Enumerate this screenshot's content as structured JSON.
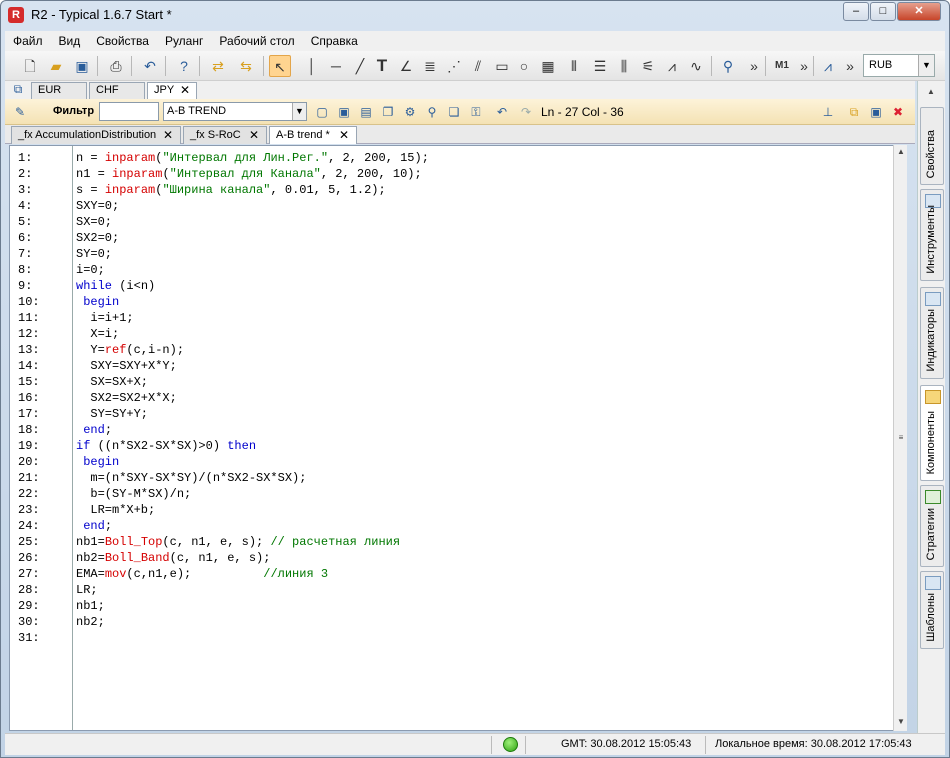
{
  "window": {
    "title": "R2 - Typical 1.6.7 Start *",
    "app_icon": "R"
  },
  "window_controls": {
    "minimize": "‒",
    "maximize": "□",
    "close": "✕"
  },
  "menu": [
    "Файл",
    "Вид",
    "Свойства",
    "Руланг",
    "Рабочий стол",
    "Справка"
  ],
  "toolbar": {
    "currency": "RUB",
    "m1": "M1",
    "more": "»",
    "text_tool": "T"
  },
  "currency_tabs": [
    "EUR",
    "CHF",
    "JPY"
  ],
  "filter": {
    "label": "Фильтр",
    "value": "",
    "selected": "A-B TREND",
    "position": "Ln - 27  Col - 36"
  },
  "file_tabs": [
    "_fx AccumulationDistribution",
    "_fx S-RoC",
    "A-B trend *"
  ],
  "code_lines": [
    {
      "n": "1:",
      "parts": [
        [
          "t",
          "n = "
        ],
        [
          "fn",
          "inparam"
        ],
        [
          "t",
          "("
        ],
        [
          "str",
          "\"Интервал для Лин.Рег.\""
        ],
        [
          "t",
          ", 2, 200, 15);"
        ]
      ]
    },
    {
      "n": "2:",
      "parts": [
        [
          "t",
          "n1 = "
        ],
        [
          "fn",
          "inparam"
        ],
        [
          "t",
          "("
        ],
        [
          "str",
          "\"Интервал для Канала\""
        ],
        [
          "t",
          ", 2, 200, 10);"
        ]
      ]
    },
    {
      "n": "3:",
      "parts": [
        [
          "t",
          "s = "
        ],
        [
          "fn",
          "inparam"
        ],
        [
          "t",
          "("
        ],
        [
          "str",
          "\"Ширина канала\""
        ],
        [
          "t",
          ", 0.01, 5, 1.2);"
        ]
      ]
    },
    {
      "n": "4:",
      "parts": [
        [
          "t",
          "SXY=0;"
        ]
      ]
    },
    {
      "n": "5:",
      "parts": [
        [
          "t",
          "SX=0;"
        ]
      ]
    },
    {
      "n": "6:",
      "parts": [
        [
          "t",
          "SX2=0;"
        ]
      ]
    },
    {
      "n": "7:",
      "parts": [
        [
          "t",
          "SY=0;"
        ]
      ]
    },
    {
      "n": "8:",
      "parts": [
        [
          "t",
          "i=0;"
        ]
      ]
    },
    {
      "n": "9:",
      "parts": [
        [
          "kw",
          "while"
        ],
        [
          "t",
          " (i<n)"
        ]
      ]
    },
    {
      "n": "10:",
      "parts": [
        [
          "t",
          " "
        ],
        [
          "kw",
          "begin"
        ]
      ]
    },
    {
      "n": "11:",
      "parts": [
        [
          "t",
          "  i=i+1;"
        ]
      ]
    },
    {
      "n": "12:",
      "parts": [
        [
          "t",
          "  X=i;"
        ]
      ]
    },
    {
      "n": "13:",
      "parts": [
        [
          "t",
          "  Y="
        ],
        [
          "fn",
          "ref"
        ],
        [
          "t",
          "(c,i-n);"
        ]
      ]
    },
    {
      "n": "14:",
      "parts": [
        [
          "t",
          "  SXY=SXY+X*Y;"
        ]
      ]
    },
    {
      "n": "15:",
      "parts": [
        [
          "t",
          "  SX=SX+X;"
        ]
      ]
    },
    {
      "n": "16:",
      "parts": [
        [
          "t",
          "  SX2=SX2+X*X;"
        ]
      ]
    },
    {
      "n": "17:",
      "parts": [
        [
          "t",
          "  SY=SY+Y;"
        ]
      ]
    },
    {
      "n": "18:",
      "parts": [
        [
          "t",
          " "
        ],
        [
          "kw",
          "end"
        ],
        [
          "t",
          ";"
        ]
      ]
    },
    {
      "n": "19:",
      "parts": [
        [
          "kw",
          "if"
        ],
        [
          "t",
          " ((n*SX2-SX*SX)>0) "
        ],
        [
          "kw",
          "then"
        ]
      ]
    },
    {
      "n": "20:",
      "parts": [
        [
          "t",
          " "
        ],
        [
          "kw",
          "begin"
        ]
      ]
    },
    {
      "n": "21:",
      "parts": [
        [
          "t",
          "  m=(n*SXY-SX*SY)/(n*SX2-SX*SX);"
        ]
      ]
    },
    {
      "n": "22:",
      "parts": [
        [
          "t",
          "  b=(SY-M*SX)/n;"
        ]
      ]
    },
    {
      "n": "23:",
      "parts": [
        [
          "t",
          "  LR=m*X+b;"
        ]
      ]
    },
    {
      "n": "24:",
      "parts": [
        [
          "t",
          " "
        ],
        [
          "kw",
          "end"
        ],
        [
          "t",
          ";"
        ]
      ]
    },
    {
      "n": "25:",
      "parts": [
        [
          "t",
          "nb1="
        ],
        [
          "fn",
          "Boll_Top"
        ],
        [
          "t",
          "(c, n1, e, s); "
        ],
        [
          "cm",
          "// расчетная линия"
        ]
      ]
    },
    {
      "n": "26:",
      "parts": [
        [
          "t",
          "nb2="
        ],
        [
          "fn",
          "Boll_Band"
        ],
        [
          "t",
          "(c, n1, e, s);"
        ]
      ]
    },
    {
      "n": "27:",
      "parts": [
        [
          "t",
          "EMA="
        ],
        [
          "fn",
          "mov"
        ],
        [
          "t",
          "(c,n1,e);          "
        ],
        [
          "cm",
          "//линия 3"
        ]
      ]
    },
    {
      "n": "28:",
      "parts": [
        [
          "t",
          "LR;"
        ]
      ]
    },
    {
      "n": "29:",
      "parts": [
        [
          "t",
          "nb1;"
        ]
      ]
    },
    {
      "n": "30:",
      "parts": [
        [
          "t",
          "nb2;"
        ]
      ]
    },
    {
      "n": "31:",
      "parts": []
    }
  ],
  "side_tabs": [
    "Свойства",
    "Инструменты",
    "Индикаторы",
    "Компоненты",
    "Стратегии",
    "Шаблоны"
  ],
  "status": {
    "gmt": "GMT:  30.08.2012 15:05:43",
    "local": "Локальное время:  30.08.2012 17:05:43"
  }
}
